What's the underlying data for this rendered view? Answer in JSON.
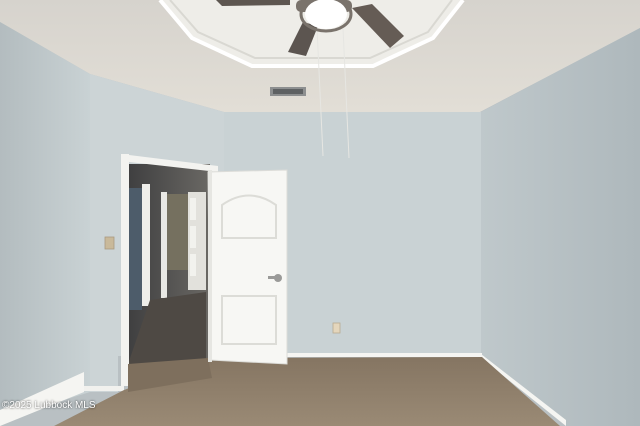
{
  "photo": {
    "watermark": "©2025 Lubbock MLS",
    "colors": {
      "ceiling": "#ddd9d2",
      "tray_trim": "#f2f2ee",
      "back_wall": "#c6d0d2",
      "left_wall": "#c2cbce",
      "right_wall": "#b4bec2",
      "carpet": "#8f7f6c",
      "door": "#f7f7f4",
      "baseboard": "#f5f5f2",
      "hall": "#5a5a5a"
    }
  }
}
